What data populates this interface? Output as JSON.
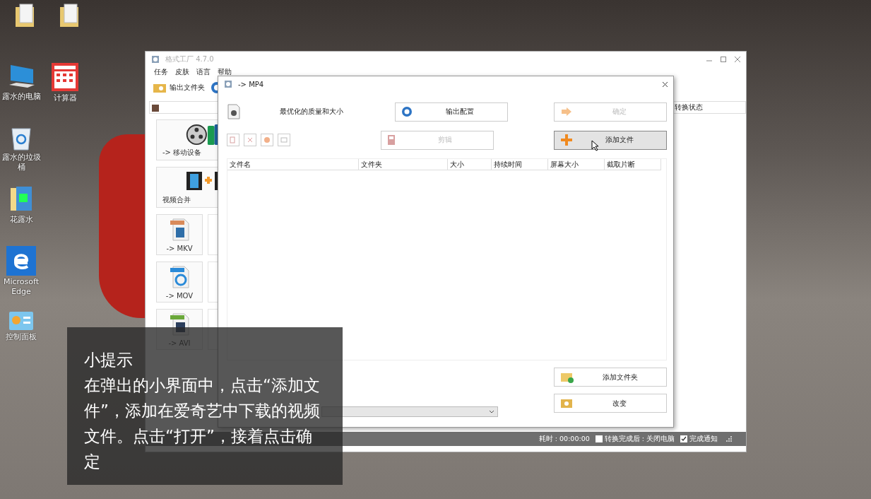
{
  "desktop_icons": [
    {
      "kind": "folder"
    },
    {
      "kind": "folder"
    },
    {
      "kind": "computer",
      "label": "露水的电脑"
    },
    {
      "kind": "calculator",
      "label": "计算器"
    },
    {
      "kind": "recycle-bin",
      "label": "露水的垃圾桶"
    },
    {
      "kind": "media-folder",
      "label": "花露水"
    },
    {
      "kind": "edge",
      "label": "Microsoft Edge"
    },
    {
      "kind": "control-panel",
      "label": "控制面板"
    }
  ],
  "main_window": {
    "title": "格式工厂 4.7.0",
    "menu": [
      "任务",
      "皮肤",
      "语言",
      "帮助"
    ],
    "toolbar": {
      "label": "输出文件夹"
    },
    "tiles": [
      {
        "kind": "mobile",
        "label": "-> 移动设备"
      },
      {
        "kind": "merge",
        "label": "视频合并"
      },
      {
        "kind": "mkv",
        "label": "-> MKV"
      },
      {
        "kind": "mov",
        "label": "-> MOV"
      },
      {
        "kind": "avi",
        "label": "-> AVI"
      }
    ],
    "status_header": "转换状态",
    "status_bar": {
      "elapsed": "耗时 : 00:00:00",
      "options": [
        {
          "label": "转换完成后 : 关闭电脑",
          "checked": false
        },
        {
          "label": "完成通知",
          "checked": true
        }
      ]
    }
  },
  "dialog": {
    "title": "-> MP4",
    "profile": "最优化的质量和大小",
    "buttons": [
      {
        "kind": "config",
        "label": "输出配置",
        "disabled": false,
        "highlighted": false
      },
      {
        "kind": "ok",
        "label": "确定",
        "disabled": true,
        "highlighted": false
      },
      {
        "kind": "clip",
        "label": "剪辑",
        "disabled": true,
        "highlighted": false
      },
      {
        "kind": "add-file",
        "label": "添加文件",
        "disabled": false,
        "highlighted": true
      },
      {
        "kind": "add-folder",
        "label": "添加文件夹",
        "disabled": false,
        "highlighted": false
      },
      {
        "kind": "change",
        "label": "改变",
        "disabled": false,
        "highlighted": false
      }
    ],
    "columns": [
      "文件名",
      "文件夹",
      "大小",
      "持续时间",
      "屏幕大小",
      "截取片断"
    ]
  },
  "tip": {
    "title": "小提示",
    "text": "在弹出的小界面中，点击“添加文件”，添加在爱奇艺中下载的视频文件。点击“打开”，接着点击确定"
  }
}
